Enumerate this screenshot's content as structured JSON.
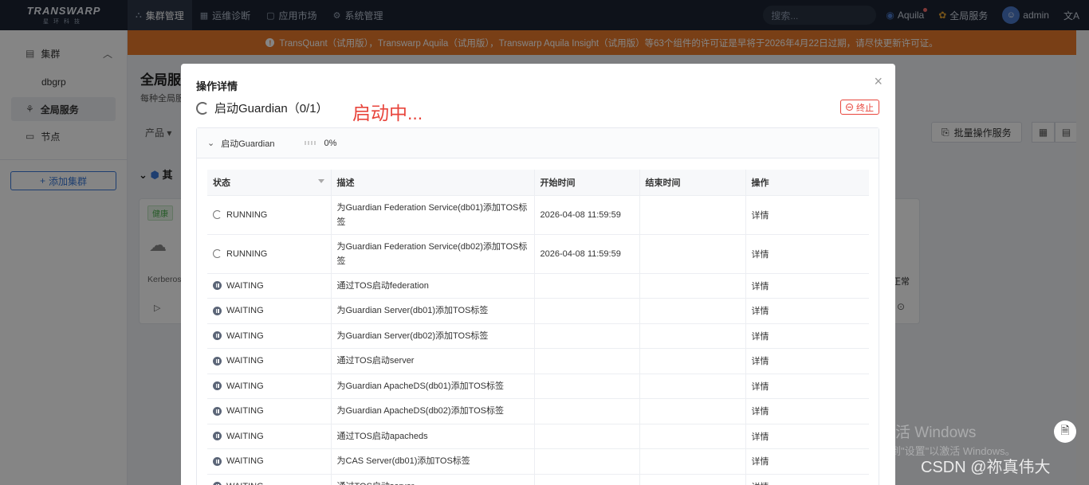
{
  "topnav": {
    "logo": "TRANSWARP",
    "logo_sub": "星环科技",
    "items": [
      {
        "label": "集群管理",
        "icon": "cluster-icon"
      },
      {
        "label": "运维诊断",
        "icon": "diagnose-icon"
      },
      {
        "label": "应用市场",
        "icon": "market-icon"
      },
      {
        "label": "系统管理",
        "icon": "gear-icon"
      }
    ],
    "search_placeholder": "搜索...",
    "aquila": "Aquila",
    "global_services": "全局服务",
    "user": "admin",
    "lang_icon": "translate-icon"
  },
  "sidebar": {
    "group": "集群",
    "items": [
      "dbgrp",
      "全局服务",
      "节点"
    ],
    "add_cluster": "添加集群"
  },
  "banner": {
    "text": "TransQuant（试用版），Transwarp Aquila（试用版），Transwarp Aquila Insight（试用版）等63个组件的许可证是早将于2026年4月22日过期，请尽快更新许可证。"
  },
  "page": {
    "title": "全局服务",
    "desc": "每种全局服",
    "product": "产品",
    "batch_button": "批量操作服务",
    "group_head": "其",
    "health_tag": "健康",
    "card_note_left": "Kerberos",
    "card_note_right": "正常"
  },
  "modal": {
    "title": "操作详情",
    "op_name": "启动Guardian（0/1）",
    "status_text": "启动中...",
    "stop_button": "终止",
    "task": {
      "name": "启动Guardian",
      "progress": 0,
      "percent": "0%"
    },
    "columns": [
      "状态",
      "描述",
      "开始时间",
      "结束时间",
      "操作"
    ],
    "rows": [
      {
        "status": "RUNNING",
        "desc": "为Guardian Federation Service(db01)添加TOS标签",
        "start": "2026-04-08 11:59:59",
        "end": "",
        "action": "详情"
      },
      {
        "status": "RUNNING",
        "desc": "为Guardian Federation Service(db02)添加TOS标签",
        "start": "2026-04-08 11:59:59",
        "end": "",
        "action": "详情"
      },
      {
        "status": "WAITING",
        "desc": "通过TOS启动federation",
        "start": "",
        "end": "",
        "action": "详情"
      },
      {
        "status": "WAITING",
        "desc": "为Guardian Server(db01)添加TOS标签",
        "start": "",
        "end": "",
        "action": "详情"
      },
      {
        "status": "WAITING",
        "desc": "为Guardian Server(db02)添加TOS标签",
        "start": "",
        "end": "",
        "action": "详情"
      },
      {
        "status": "WAITING",
        "desc": "通过TOS启动server",
        "start": "",
        "end": "",
        "action": "详情"
      },
      {
        "status": "WAITING",
        "desc": "为Guardian ApacheDS(db01)添加TOS标签",
        "start": "",
        "end": "",
        "action": "详情"
      },
      {
        "status": "WAITING",
        "desc": "为Guardian ApacheDS(db02)添加TOS标签",
        "start": "",
        "end": "",
        "action": "详情"
      },
      {
        "status": "WAITING",
        "desc": "通过TOS启动apacheds",
        "start": "",
        "end": "",
        "action": "详情"
      },
      {
        "status": "WAITING",
        "desc": "为CAS Server(db01)添加TOS标签",
        "start": "",
        "end": "",
        "action": "详情"
      },
      {
        "status": "WAITING",
        "desc": "通过TOS启动server",
        "start": "",
        "end": "",
        "action": "详情"
      }
    ]
  },
  "watermark": {
    "line1": "激活 Windows",
    "line2": "转到\"设置\"以激活 Windows。",
    "csdn": "CSDN @祢真伟大"
  }
}
